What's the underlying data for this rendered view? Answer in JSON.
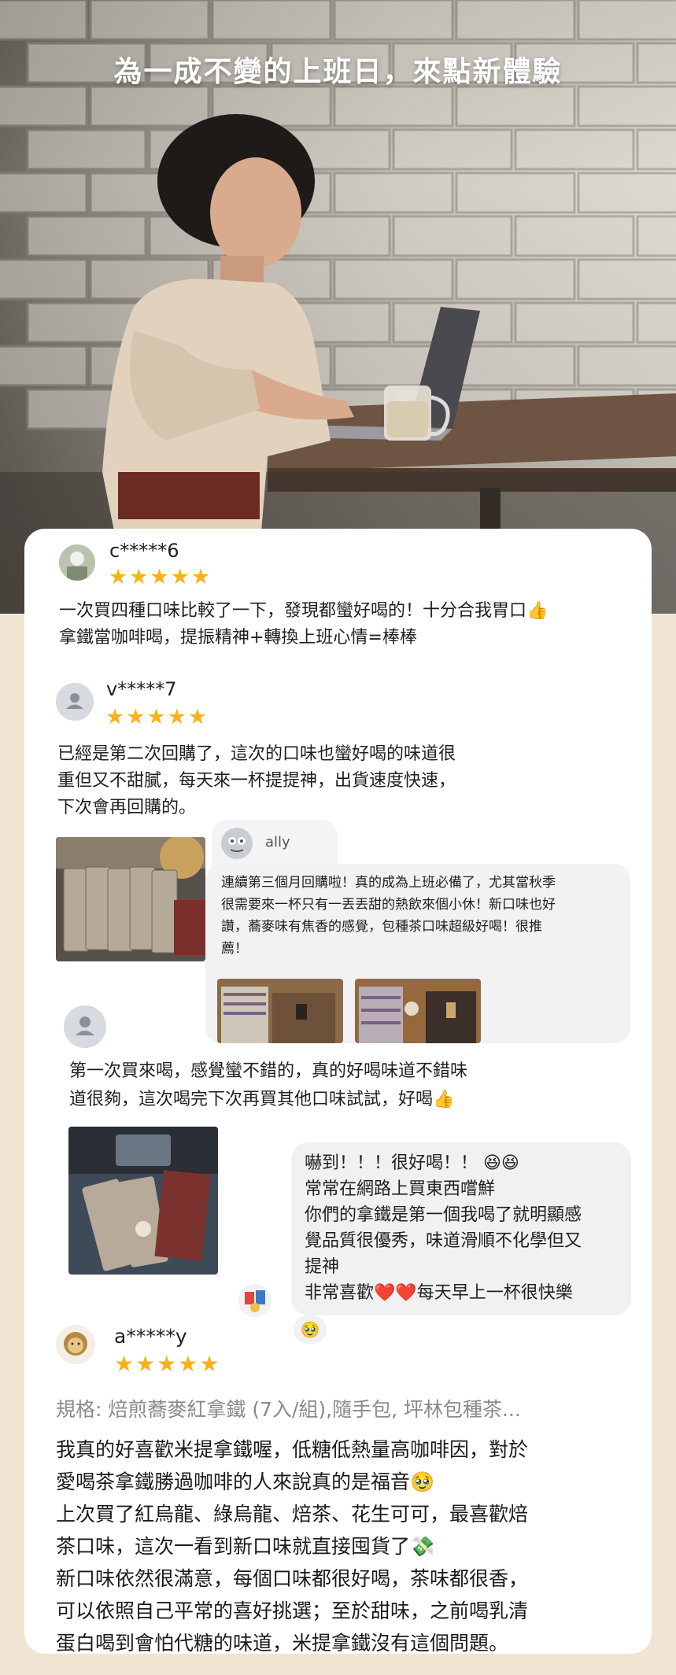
{
  "hero": {
    "title": "為一成不變的上班日，來點新體驗"
  },
  "reviews": [
    {
      "user": "c*****6",
      "stars": "★★★★★",
      "text": "一次買四種口味比較了一下，發現都蠻好喝的！十分合我胃口👍\n拿鐵當咖啡喝，提振精神+轉換上班心情=棒棒"
    },
    {
      "user": "v*****7",
      "stars": "★★★★★",
      "text": "已經是第二次回購了，這次的口味也蠻好喝的味道很\n重但又不甜膩，每天來一杯提提神，出貨速度快速，\n下次會再回購的。"
    },
    {
      "user": "ally",
      "text": "連續第三個月回購啦！真的成為上班必備了，尤其當秋季\n很需要來一杯只有一丟丟甜的熱飲來個小休！新口味也好\n讚，蕎麥味有焦香的感覺，包種茶口味超級好喝！很推\n薦！"
    },
    {
      "text": "第一次買來喝，感覺蠻不錯的，真的好喝味道不錯味\n道很夠，這次喝完下次再買其他口味試試，好喝👍"
    },
    {
      "text": "嚇到！！！很好喝！！ 😆😆\n常常在網路上買東西嚐鮮\n你們的拿鐵是第一個我喝了就明顯感\n覺品質很優秀，味道滑順不化學但又\n提神\n非常喜歡❤️❤️每天早上一杯很快樂",
      "reaction": "🥹"
    },
    {
      "user": "a*****y",
      "stars": "★★★★★",
      "spec": "規格: 焙煎蕎麥紅拿鐵 (7入/組),隨手包, 坪林包種茶...",
      "text": "我真的好喜歡米提拿鐵喔，低糖低熱量高咖啡因，對於\n愛喝茶拿鐵勝過咖啡的人來說真的是福音🥹\n上次買了紅烏龍、綠烏龍、焙茶、花生可可，最喜歡焙\n茶口味，這次一看到新口味就直接囤貨了💸\n新口味依然很滿意，每個口味都很好喝，茶味都很香，\n可以依照自己平常的喜好挑選；至於甜味，之前喝乳清\n蛋白喝到會怕代糖的味道，米提拿鐵沒有這個問題。"
    }
  ],
  "colors": {
    "background": "#efe5d2",
    "card": "#ffffff",
    "star": "#f7b21a",
    "bubble": "#f2f2f4",
    "spec_text": "#8a8a8a"
  },
  "icons": [
    "thumbs-up-icon",
    "user-icon",
    "heart-icon",
    "star-icon"
  ]
}
